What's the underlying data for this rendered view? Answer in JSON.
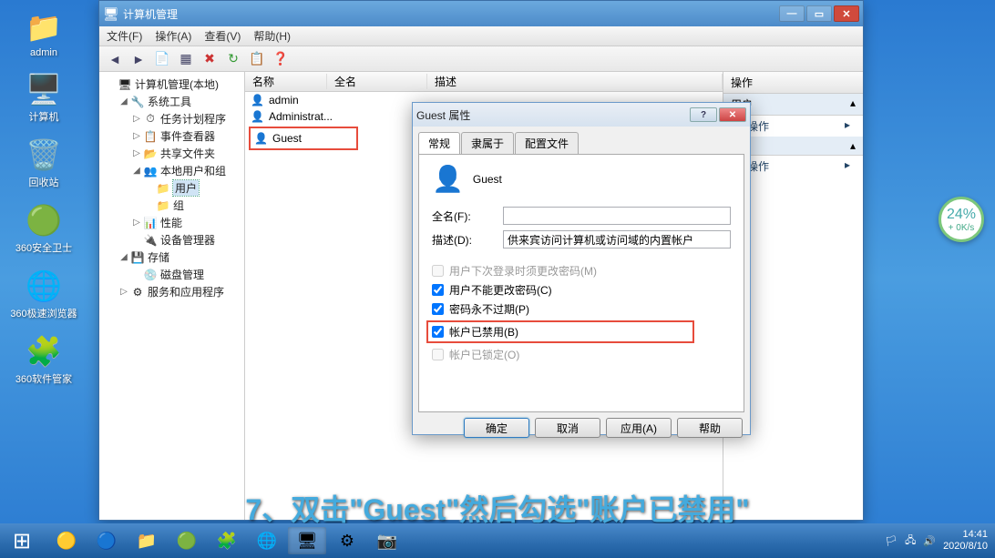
{
  "desktop": {
    "icons": [
      {
        "name": "admin",
        "glyph": "📁"
      },
      {
        "name": "计算机",
        "glyph": "🖥️"
      },
      {
        "name": "回收站",
        "glyph": "🗑️"
      },
      {
        "name": "360安全卫士",
        "glyph": "🟢"
      },
      {
        "name": "360极速浏览器",
        "glyph": "🌐"
      },
      {
        "name": "360软件管家",
        "glyph": "🧩"
      }
    ]
  },
  "main_window": {
    "title": "计算机管理",
    "menu": [
      "文件(F)",
      "操作(A)",
      "查看(V)",
      "帮助(H)"
    ],
    "tree": [
      {
        "lvl": 1,
        "exp": "",
        "icon": "🖥",
        "label": "计算机管理(本地)"
      },
      {
        "lvl": 2,
        "exp": "◢",
        "icon": "🔧",
        "label": "系统工具"
      },
      {
        "lvl": 3,
        "exp": "▷",
        "icon": "⏱",
        "label": "任务计划程序"
      },
      {
        "lvl": 3,
        "exp": "▷",
        "icon": "📋",
        "label": "事件查看器"
      },
      {
        "lvl": 3,
        "exp": "▷",
        "icon": "📂",
        "label": "共享文件夹"
      },
      {
        "lvl": 3,
        "exp": "◢",
        "icon": "👥",
        "label": "本地用户和组"
      },
      {
        "lvl": 4,
        "exp": "",
        "icon": "📁",
        "label": "用户",
        "selected": true
      },
      {
        "lvl": 4,
        "exp": "",
        "icon": "📁",
        "label": "组"
      },
      {
        "lvl": 3,
        "exp": "▷",
        "icon": "📊",
        "label": "性能"
      },
      {
        "lvl": 3,
        "exp": "",
        "icon": "🔌",
        "label": "设备管理器"
      },
      {
        "lvl": 2,
        "exp": "◢",
        "icon": "💾",
        "label": "存储"
      },
      {
        "lvl": 3,
        "exp": "",
        "icon": "💿",
        "label": "磁盘管理"
      },
      {
        "lvl": 2,
        "exp": "▷",
        "icon": "⚙",
        "label": "服务和应用程序"
      }
    ],
    "list": {
      "headers": [
        "名称",
        "全名",
        "描述"
      ],
      "rows": [
        {
          "name": "admin"
        },
        {
          "name": "Administrat..."
        },
        {
          "name": "Guest",
          "highlight": true
        }
      ]
    },
    "actions": {
      "header": "操作",
      "group1": "用户",
      "item1": "多操作",
      "group2": "",
      "item2": "多操作"
    }
  },
  "dialog": {
    "title": "Guest 属性",
    "tabs": [
      "常规",
      "隶属于",
      "配置文件"
    ],
    "user_name": "Guest",
    "fullname_label": "全名(F):",
    "fullname_value": "",
    "desc_label": "描述(D):",
    "desc_value": "供来宾访问计算机或访问域的内置帐户",
    "checks": [
      {
        "label": "用户下次登录时须更改密码(M)",
        "checked": false,
        "disabled": true
      },
      {
        "label": "用户不能更改密码(C)",
        "checked": true
      },
      {
        "label": "密码永不过期(P)",
        "checked": true
      },
      {
        "label": "帐户已禁用(B)",
        "checked": true,
        "highlight": true
      },
      {
        "label": "帐户已锁定(O)",
        "checked": false,
        "disabled": true
      }
    ],
    "buttons": {
      "ok": "确定",
      "cancel": "取消",
      "apply": "应用(A)",
      "help": "帮助"
    }
  },
  "subtitle": "7、双击\"Guest\"然后勾选\"账户已禁用\"",
  "speed": {
    "pct": "24%",
    "rate": "+ 0K/s"
  },
  "taskbar": {
    "clock_time": "14:41",
    "clock_date": "2020/8/10"
  }
}
